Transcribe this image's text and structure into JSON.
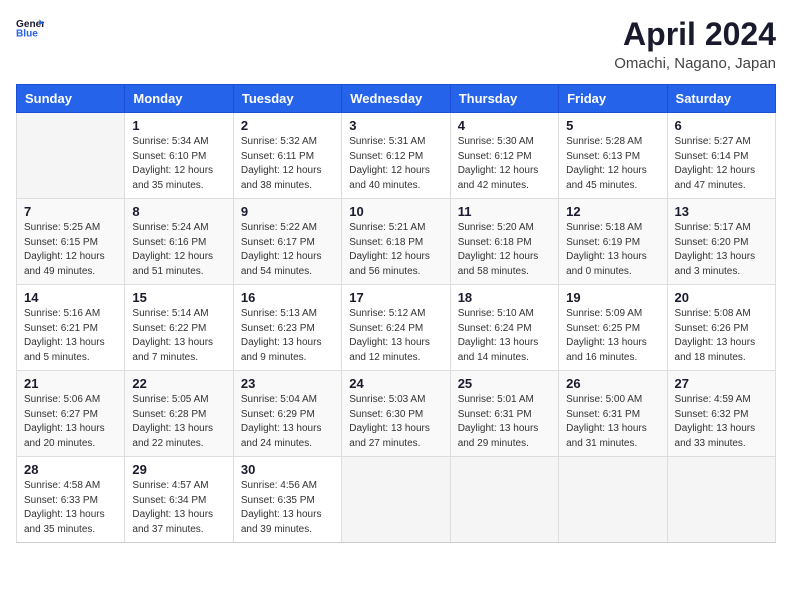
{
  "header": {
    "logo": {
      "general": "General",
      "blue": "Blue"
    },
    "title": "April 2024",
    "location": "Omachi, Nagano, Japan"
  },
  "weekdays": [
    "Sunday",
    "Monday",
    "Tuesday",
    "Wednesday",
    "Thursday",
    "Friday",
    "Saturday"
  ],
  "weeks": [
    [
      {
        "day": "",
        "info": ""
      },
      {
        "day": "1",
        "info": "Sunrise: 5:34 AM\nSunset: 6:10 PM\nDaylight: 12 hours\nand 35 minutes."
      },
      {
        "day": "2",
        "info": "Sunrise: 5:32 AM\nSunset: 6:11 PM\nDaylight: 12 hours\nand 38 minutes."
      },
      {
        "day": "3",
        "info": "Sunrise: 5:31 AM\nSunset: 6:12 PM\nDaylight: 12 hours\nand 40 minutes."
      },
      {
        "day": "4",
        "info": "Sunrise: 5:30 AM\nSunset: 6:12 PM\nDaylight: 12 hours\nand 42 minutes."
      },
      {
        "day": "5",
        "info": "Sunrise: 5:28 AM\nSunset: 6:13 PM\nDaylight: 12 hours\nand 45 minutes."
      },
      {
        "day": "6",
        "info": "Sunrise: 5:27 AM\nSunset: 6:14 PM\nDaylight: 12 hours\nand 47 minutes."
      }
    ],
    [
      {
        "day": "7",
        "info": "Sunrise: 5:25 AM\nSunset: 6:15 PM\nDaylight: 12 hours\nand 49 minutes."
      },
      {
        "day": "8",
        "info": "Sunrise: 5:24 AM\nSunset: 6:16 PM\nDaylight: 12 hours\nand 51 minutes."
      },
      {
        "day": "9",
        "info": "Sunrise: 5:22 AM\nSunset: 6:17 PM\nDaylight: 12 hours\nand 54 minutes."
      },
      {
        "day": "10",
        "info": "Sunrise: 5:21 AM\nSunset: 6:18 PM\nDaylight: 12 hours\nand 56 minutes."
      },
      {
        "day": "11",
        "info": "Sunrise: 5:20 AM\nSunset: 6:18 PM\nDaylight: 12 hours\nand 58 minutes."
      },
      {
        "day": "12",
        "info": "Sunrise: 5:18 AM\nSunset: 6:19 PM\nDaylight: 13 hours\nand 0 minutes."
      },
      {
        "day": "13",
        "info": "Sunrise: 5:17 AM\nSunset: 6:20 PM\nDaylight: 13 hours\nand 3 minutes."
      }
    ],
    [
      {
        "day": "14",
        "info": "Sunrise: 5:16 AM\nSunset: 6:21 PM\nDaylight: 13 hours\nand 5 minutes."
      },
      {
        "day": "15",
        "info": "Sunrise: 5:14 AM\nSunset: 6:22 PM\nDaylight: 13 hours\nand 7 minutes."
      },
      {
        "day": "16",
        "info": "Sunrise: 5:13 AM\nSunset: 6:23 PM\nDaylight: 13 hours\nand 9 minutes."
      },
      {
        "day": "17",
        "info": "Sunrise: 5:12 AM\nSunset: 6:24 PM\nDaylight: 13 hours\nand 12 minutes."
      },
      {
        "day": "18",
        "info": "Sunrise: 5:10 AM\nSunset: 6:24 PM\nDaylight: 13 hours\nand 14 minutes."
      },
      {
        "day": "19",
        "info": "Sunrise: 5:09 AM\nSunset: 6:25 PM\nDaylight: 13 hours\nand 16 minutes."
      },
      {
        "day": "20",
        "info": "Sunrise: 5:08 AM\nSunset: 6:26 PM\nDaylight: 13 hours\nand 18 minutes."
      }
    ],
    [
      {
        "day": "21",
        "info": "Sunrise: 5:06 AM\nSunset: 6:27 PM\nDaylight: 13 hours\nand 20 minutes."
      },
      {
        "day": "22",
        "info": "Sunrise: 5:05 AM\nSunset: 6:28 PM\nDaylight: 13 hours\nand 22 minutes."
      },
      {
        "day": "23",
        "info": "Sunrise: 5:04 AM\nSunset: 6:29 PM\nDaylight: 13 hours\nand 24 minutes."
      },
      {
        "day": "24",
        "info": "Sunrise: 5:03 AM\nSunset: 6:30 PM\nDaylight: 13 hours\nand 27 minutes."
      },
      {
        "day": "25",
        "info": "Sunrise: 5:01 AM\nSunset: 6:31 PM\nDaylight: 13 hours\nand 29 minutes."
      },
      {
        "day": "26",
        "info": "Sunrise: 5:00 AM\nSunset: 6:31 PM\nDaylight: 13 hours\nand 31 minutes."
      },
      {
        "day": "27",
        "info": "Sunrise: 4:59 AM\nSunset: 6:32 PM\nDaylight: 13 hours\nand 33 minutes."
      }
    ],
    [
      {
        "day": "28",
        "info": "Sunrise: 4:58 AM\nSunset: 6:33 PM\nDaylight: 13 hours\nand 35 minutes."
      },
      {
        "day": "29",
        "info": "Sunrise: 4:57 AM\nSunset: 6:34 PM\nDaylight: 13 hours\nand 37 minutes."
      },
      {
        "day": "30",
        "info": "Sunrise: 4:56 AM\nSunset: 6:35 PM\nDaylight: 13 hours\nand 39 minutes."
      },
      {
        "day": "",
        "info": ""
      },
      {
        "day": "",
        "info": ""
      },
      {
        "day": "",
        "info": ""
      },
      {
        "day": "",
        "info": ""
      }
    ]
  ]
}
